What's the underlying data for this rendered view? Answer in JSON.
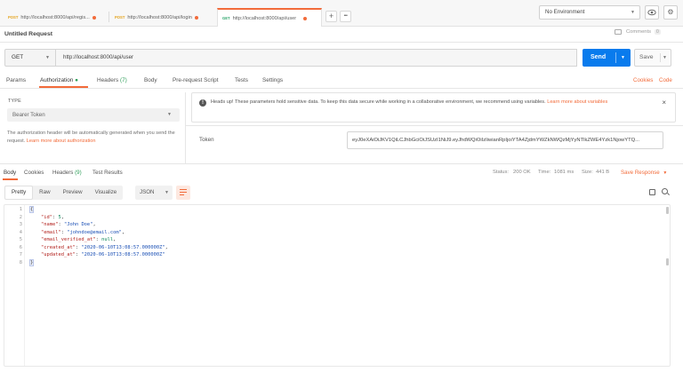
{
  "tabs": [
    {
      "method": "POST",
      "label": "http://localhost:8000/api/regis..."
    },
    {
      "method": "POST",
      "label": "http://localhost:8000/api/login"
    },
    {
      "method": "GET",
      "label": "http://localhost:8000/api/user"
    }
  ],
  "tab_actions": {
    "add": "+",
    "more": "•••"
  },
  "environment": {
    "selected": "No Environment"
  },
  "header_icons": {
    "eye": "eye-icon",
    "settings": "gear-icon"
  },
  "request": {
    "title": "Untitled Request",
    "comments_label": "Comments",
    "comments_count": "0",
    "method": "GET",
    "url": "http://localhost:8000/api/user",
    "send_label": "Send",
    "save_label": "Save"
  },
  "request_tabs": {
    "params": "Params",
    "authorization": "Authorization",
    "headers": "Headers",
    "headers_count": "(7)",
    "body": "Body",
    "prerequest": "Pre-request Script",
    "tests": "Tests",
    "settings": "Settings",
    "cookies": "Cookies",
    "code": "Code"
  },
  "auth": {
    "type_label": "TYPE",
    "type_value": "Bearer Token",
    "help_text": "The authorization header will be automatically generated when you send the request. ",
    "help_link": "Learn more about authorization",
    "alert_text": "Heads up! These parameters hold sensitive data. To keep this data secure while working in a collaborative environment, we recommend using variables. ",
    "alert_link": "Learn more about variables",
    "token_label": "Token",
    "token_value": "eyJ0eXAiOiJKV1QiLCJhbGciOiJSUzI1NiJ9.eyJhdWQiOiIzIiwianRpIjoiYTA4ZjdmYWZkNWQzMjYyNTlkZWE4Yzk1NjowYTQ..."
  },
  "response_tabs": {
    "body": "Body",
    "cookies": "Cookies",
    "headers": "Headers",
    "headers_count": "(9)",
    "test_results": "Test Results"
  },
  "response_meta": {
    "status_label": "Status:",
    "status_value": "200 OK",
    "time_label": "Time:",
    "time_value": "1081 ms",
    "size_label": "Size:",
    "size_value": "441 B",
    "save_response": "Save Response"
  },
  "view_modes": [
    "Pretty",
    "Raw",
    "Preview",
    "Visualize"
  ],
  "format": "JSON",
  "response_lines": [
    {
      "num": "1",
      "indent": "",
      "key": "",
      "value": "",
      "text": "{"
    },
    {
      "num": "2",
      "indent": "    ",
      "key": "\"id\"",
      "value": "5",
      "vtype": "n",
      "tail": ","
    },
    {
      "num": "3",
      "indent": "    ",
      "key": "\"name\"",
      "value": "\"John Doe\"",
      "vtype": "s",
      "tail": ","
    },
    {
      "num": "4",
      "indent": "    ",
      "key": "\"email\"",
      "value": "\"johndoe@email.com\"",
      "vtype": "s",
      "tail": ","
    },
    {
      "num": "5",
      "indent": "    ",
      "key": "\"email_verified_at\"",
      "value": "null",
      "vtype": "n",
      "tail": ","
    },
    {
      "num": "6",
      "indent": "    ",
      "key": "\"created_at\"",
      "value": "\"2020-06-10T13:08:57.000000Z\"",
      "vtype": "s",
      "tail": ","
    },
    {
      "num": "7",
      "indent": "    ",
      "key": "\"updated_at\"",
      "value": "\"2020-06-10T13:08:57.000000Z\"",
      "vtype": "s",
      "tail": ""
    },
    {
      "num": "8",
      "indent": "",
      "key": "",
      "value": "",
      "text": "}"
    }
  ],
  "colors": {
    "accent": "#f26b3a",
    "send": "#097bed",
    "success": "#2e9e59"
  }
}
